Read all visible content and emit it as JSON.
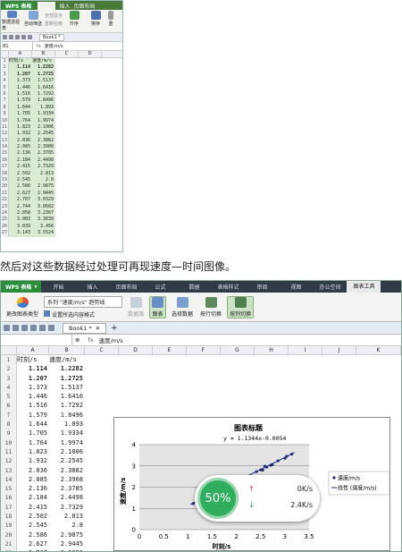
{
  "top_window": {
    "app_name": "WPS 表格",
    "menu_tabs": [
      "开始",
      "插入",
      "页面布局"
    ],
    "ribbon": {
      "btn1": "数据透视表",
      "btn2": "自动筛选",
      "small1": "全部显示",
      "small2": "重新应用",
      "btn3": "升序",
      "btn4": "排序",
      "btn5": "重"
    },
    "doc_tab": "Book1 *",
    "name_box": "B1",
    "fx": "fx",
    "formula": "速度/m/s",
    "columns": [
      "A",
      "B",
      "C",
      "D"
    ],
    "rows": [
      [
        "1",
        "时刻/s",
        "速度/m/s"
      ],
      [
        "2",
        "1.114",
        "1.2282"
      ],
      [
        "3",
        "1.207",
        "1.2725"
      ],
      [
        "4",
        "1.373",
        "1.5137"
      ],
      [
        "5",
        "1.446",
        "1.6416"
      ],
      [
        "6",
        "1.516",
        "1.7292"
      ],
      [
        "7",
        "1.579",
        "1.8496"
      ],
      [
        "8",
        "1.644",
        "1.893"
      ],
      [
        "9",
        "1.705",
        "1.9334"
      ],
      [
        "10",
        "1.764",
        "1.9974"
      ],
      [
        "11",
        "1.823",
        "2.1006"
      ],
      [
        "12",
        "1.932",
        "2.2545"
      ],
      [
        "13",
        "2.036",
        "2.3882"
      ],
      [
        "14",
        "2.085",
        "2.3908"
      ],
      [
        "15",
        "2.136",
        "2.3785"
      ],
      [
        "16",
        "2.184",
        "2.4498"
      ],
      [
        "17",
        "2.415",
        "2.7329"
      ],
      [
        "18",
        "2.502",
        "2.813"
      ],
      [
        "19",
        "2.545",
        "2.8"
      ],
      [
        "20",
        "2.586",
        "2.9875"
      ],
      [
        "21",
        "2.627",
        "2.9445"
      ],
      [
        "22",
        "2.707",
        "3.0329"
      ],
      [
        "23",
        "2.744",
        "3.0602"
      ],
      [
        "24",
        "2.858",
        "3.2367"
      ],
      [
        "25",
        "3.003",
        "3.3639"
      ],
      [
        "26",
        "3.039",
        "3.456"
      ],
      [
        "27",
        "3.143",
        "3.5524"
      ]
    ]
  },
  "caption": "然后对这些数据经过处理可再现速度—时间图像。",
  "bottom_window": {
    "app_name": "WPS 表格",
    "menu_tabs": [
      "开始",
      "插入",
      "页面布局",
      "公式",
      "数据",
      "表格样式",
      "审阅",
      "视图",
      "办公空间",
      "图表工具"
    ],
    "selected_tab": "图表工具",
    "ribbon": {
      "change_type": "更改图表类型",
      "series_combo": "系列 \"速度/m/s\" 趋势线",
      "format_selection": "设置所选内容格式",
      "data_source": "数据源",
      "chart": "图表",
      "select_data": "选择数据",
      "switch_row": "按行切换",
      "switch_col": "按列切换"
    },
    "doc_tab": "Book1 *",
    "fx": "fx",
    "formula": "速度/m/s",
    "columns": [
      "A",
      "B",
      "C",
      "D",
      "E",
      "F",
      "G",
      "H",
      "I",
      "J",
      "K"
    ],
    "rows": [
      [
        "1",
        "时刻/s",
        "速度/m/s"
      ],
      [
        "2",
        "1.114",
        "1.2282"
      ],
      [
        "3",
        "1.207",
        "1.2725"
      ],
      [
        "4",
        "1.373",
        "1.5137"
      ],
      [
        "5",
        "1.446",
        "1.6416"
      ],
      [
        "6",
        "1.516",
        "1.7292"
      ],
      [
        "7",
        "1.579",
        "1.8496"
      ],
      [
        "8",
        "1.644",
        "1.893"
      ],
      [
        "9",
        "1.705",
        "1.9334"
      ],
      [
        "10",
        "1.764",
        "1.9974"
      ],
      [
        "11",
        "1.823",
        "2.1006"
      ],
      [
        "12",
        "1.932",
        "2.2545"
      ],
      [
        "13",
        "2.036",
        "2.3882"
      ],
      [
        "14",
        "2.085",
        "2.3908"
      ],
      [
        "15",
        "2.136",
        "2.3785"
      ],
      [
        "16",
        "2.184",
        "2.4498"
      ],
      [
        "17",
        "2.415",
        "2.7329"
      ],
      [
        "18",
        "2.502",
        "2.813"
      ],
      [
        "19",
        "2.545",
        "2.8"
      ],
      [
        "20",
        "2.586",
        "2.9875"
      ],
      [
        "21",
        "2.627",
        "2.9445"
      ],
      [
        "22",
        "2.707",
        "3.0329"
      ]
    ]
  },
  "overlay": {
    "percent": "50%",
    "upload": "0K/s",
    "download": "2.4K/s",
    "percent_value": 50
  },
  "chart_data": {
    "type": "scatter",
    "title": "图表标题",
    "equation": "y = 1.1344x-0.0054",
    "xlabel": "时刻/s",
    "ylabel": "速度/m/s",
    "xlim": [
      0,
      3.5
    ],
    "ylim": [
      0,
      4
    ],
    "xticks": [
      "0",
      "0.5",
      "1",
      "1.5",
      "2",
      "2.5",
      "3",
      "3.5"
    ],
    "yticks": [
      "0",
      "1",
      "2",
      "3",
      "4"
    ],
    "legend": [
      "速度/m/s",
      "线性 (速度/m/s)"
    ],
    "legend_position": "right",
    "trendline": {
      "slope": 1.1344,
      "intercept": -0.0054
    },
    "series": [
      {
        "name": "速度/m/s",
        "x": [
          1.114,
          1.207,
          1.373,
          1.446,
          1.516,
          1.579,
          1.644,
          1.705,
          1.764,
          1.823,
          1.932,
          2.036,
          2.085,
          2.136,
          2.184,
          2.415,
          2.502,
          2.545,
          2.586,
          2.627,
          2.707,
          2.744,
          2.858,
          3.003,
          3.039,
          3.143
        ],
        "y": [
          1.2282,
          1.2725,
          1.5137,
          1.6416,
          1.7292,
          1.8496,
          1.893,
          1.9334,
          1.9974,
          2.1006,
          2.2545,
          2.3882,
          2.3908,
          2.3785,
          2.4498,
          2.7329,
          2.813,
          2.8,
          2.9875,
          2.9445,
          3.0329,
          3.0602,
          3.2367,
          3.3639,
          3.456,
          3.5524
        ]
      }
    ],
    "colors": {
      "plot_bg": "#e4e4e4",
      "marker": "#1f2a7a",
      "trend": "#1f2a7a"
    }
  }
}
